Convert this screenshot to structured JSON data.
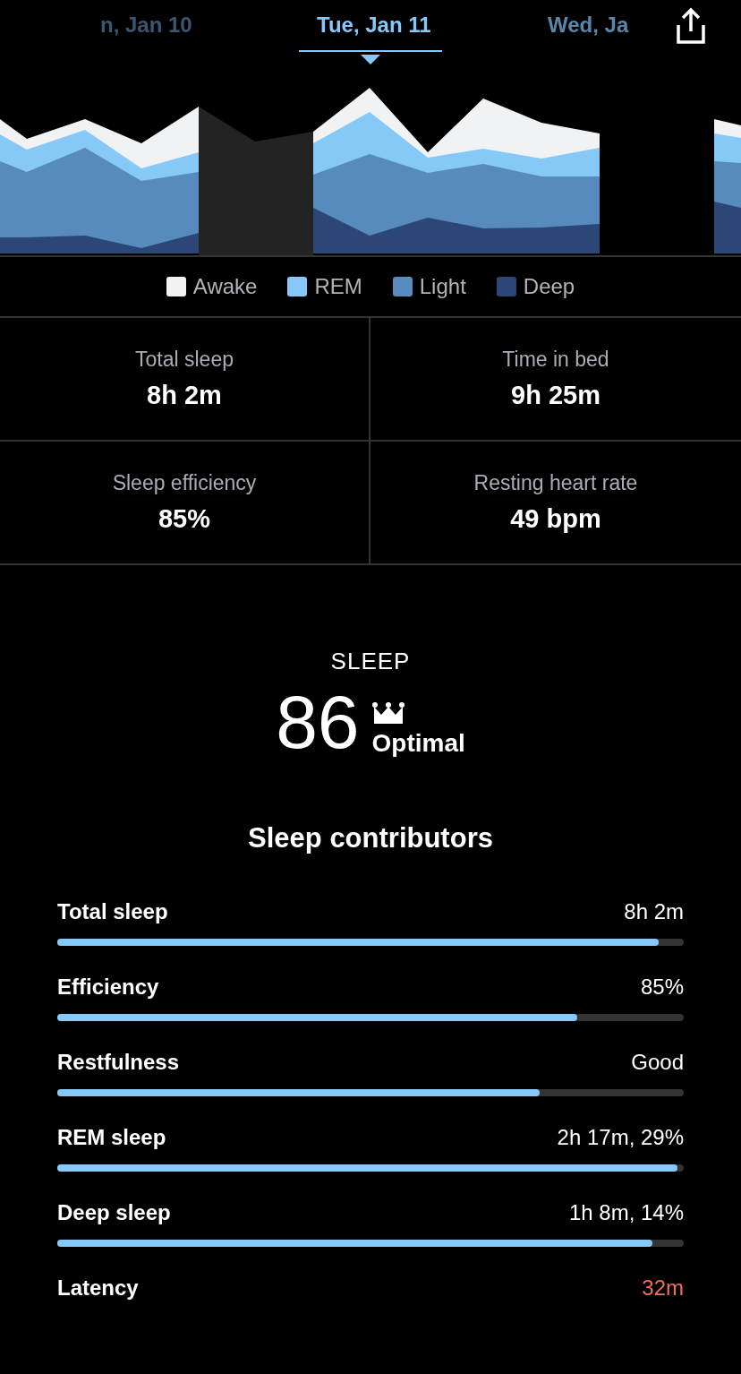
{
  "date_tabs": [
    {
      "label": "n, Jan 10",
      "selected": false
    },
    {
      "label": "Tue, Jan 11",
      "selected": true
    },
    {
      "label": "Wed, Ja",
      "selected": false
    }
  ],
  "legend": [
    {
      "label": "Awake",
      "color": "#f1f2f4"
    },
    {
      "label": "REM",
      "color": "#86c8f8"
    },
    {
      "label": "Light",
      "color": "#588bbd"
    },
    {
      "label": "Deep",
      "color": "#2c4678"
    }
  ],
  "stats": [
    {
      "label": "Total sleep",
      "value": "8h 2m"
    },
    {
      "label": "Time in bed",
      "value": "9h 25m"
    },
    {
      "label": "Sleep efficiency",
      "value": "85%"
    },
    {
      "label": "Resting heart rate",
      "value": "49 bpm"
    }
  ],
  "score": {
    "title": "SLEEP",
    "value": "86",
    "rating": "Optimal"
  },
  "contributors_title": "Sleep contributors",
  "contributors": [
    {
      "label": "Total sleep",
      "value": "8h 2m",
      "level": 0.96,
      "alert": false
    },
    {
      "label": "Efficiency",
      "value": "85%",
      "level": 0.83,
      "alert": false
    },
    {
      "label": "Restfulness",
      "value": "Good",
      "level": 0.77,
      "alert": false
    },
    {
      "label": "REM sleep",
      "value": "2h 17m, 29%",
      "level": 0.99,
      "alert": false
    },
    {
      "label": "Deep sleep",
      "value": "1h 8m, 14%",
      "level": 0.95,
      "alert": false
    },
    {
      "label": "Latency",
      "value": "32m",
      "alert": true
    }
  ]
}
